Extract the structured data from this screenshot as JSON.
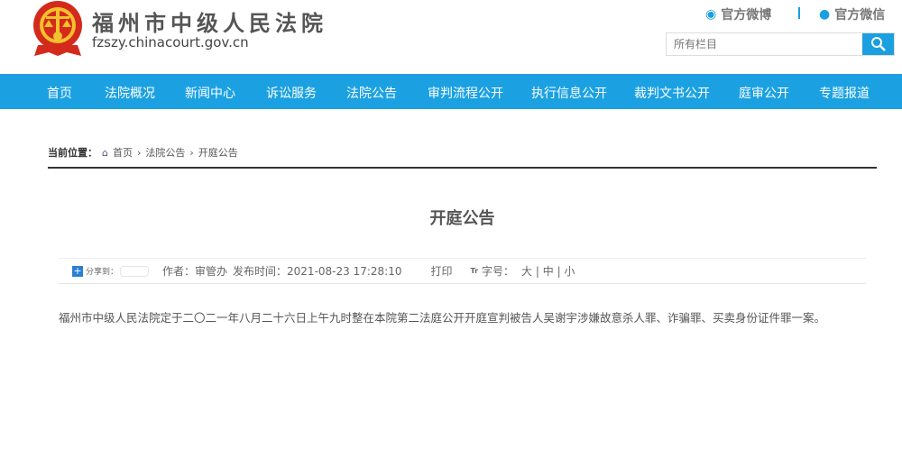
{
  "header": {
    "site_name": "福州市中级人民法院",
    "site_url": "fzszy.chinacourt.gov.cn",
    "weibo": "官方微博",
    "wechat": "官方微信",
    "search_placeholder": "所有栏目"
  },
  "nav": [
    "首页",
    "法院概况",
    "新闻中心",
    "诉讼服务",
    "法院公告",
    "审判流程公开",
    "执行信息公开",
    "裁判文书公开",
    "庭审公开",
    "专题报道"
  ],
  "breadcrumb": {
    "label": "当前位置：",
    "items": [
      "首页",
      "法院公告",
      "开庭公告"
    ]
  },
  "article": {
    "title": "开庭公告",
    "share": "分享到：",
    "author": "作者：审管办",
    "publish": "发布时间：2021-08-23 17:28:10",
    "print": "打印",
    "font_label": "字号：",
    "sizes": [
      "大",
      "中",
      "小"
    ],
    "body": "福州市中级人民法院定于二〇二一年八月二十六日上午九时整在本院第二法庭公开开庭宣判被告人吴谢宇涉嫌故意杀人罪、诈骗罪、买卖身份证件罪一案。"
  },
  "colors": {
    "accent": "#1ba1e2"
  }
}
